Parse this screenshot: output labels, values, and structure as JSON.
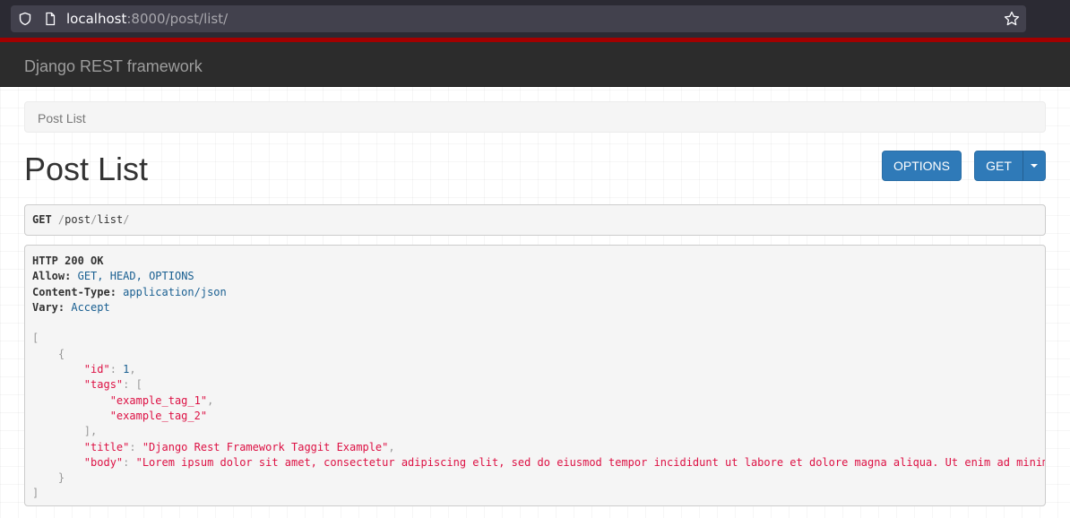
{
  "browser": {
    "url_host": "localhost",
    "url_rest": ":8000/post/list/"
  },
  "navbar": {
    "brand": "Django REST framework"
  },
  "breadcrumb": {
    "current": "Post List"
  },
  "page": {
    "title": "Post List"
  },
  "buttons": {
    "options": "OPTIONS",
    "get": "GET"
  },
  "request": {
    "method": "GET",
    "path_parts": [
      "/",
      "post",
      "/",
      "list",
      "/"
    ]
  },
  "response": {
    "status": "HTTP 200 OK",
    "headers": [
      {
        "name": "Allow:",
        "value": "GET, HEAD, OPTIONS"
      },
      {
        "name": "Content-Type:",
        "value": "application/json"
      },
      {
        "name": "Vary:",
        "value": "Accept"
      }
    ],
    "body": {
      "id_key": "\"id\"",
      "id_value": "1",
      "tags_key": "\"tags\"",
      "tags": [
        "\"example_tag_1\"",
        "\"example_tag_2\""
      ],
      "title_key": "\"title\"",
      "title_value": "\"Django Rest Framework Taggit Example\"",
      "body_key": "\"body\"",
      "body_value": "\"Lorem ipsum dolor sit amet, consectetur adipiscing elit, sed do eiusmod tempor incididunt ut labore et dolore magna aliqua. Ut enim ad minim"
    }
  }
}
